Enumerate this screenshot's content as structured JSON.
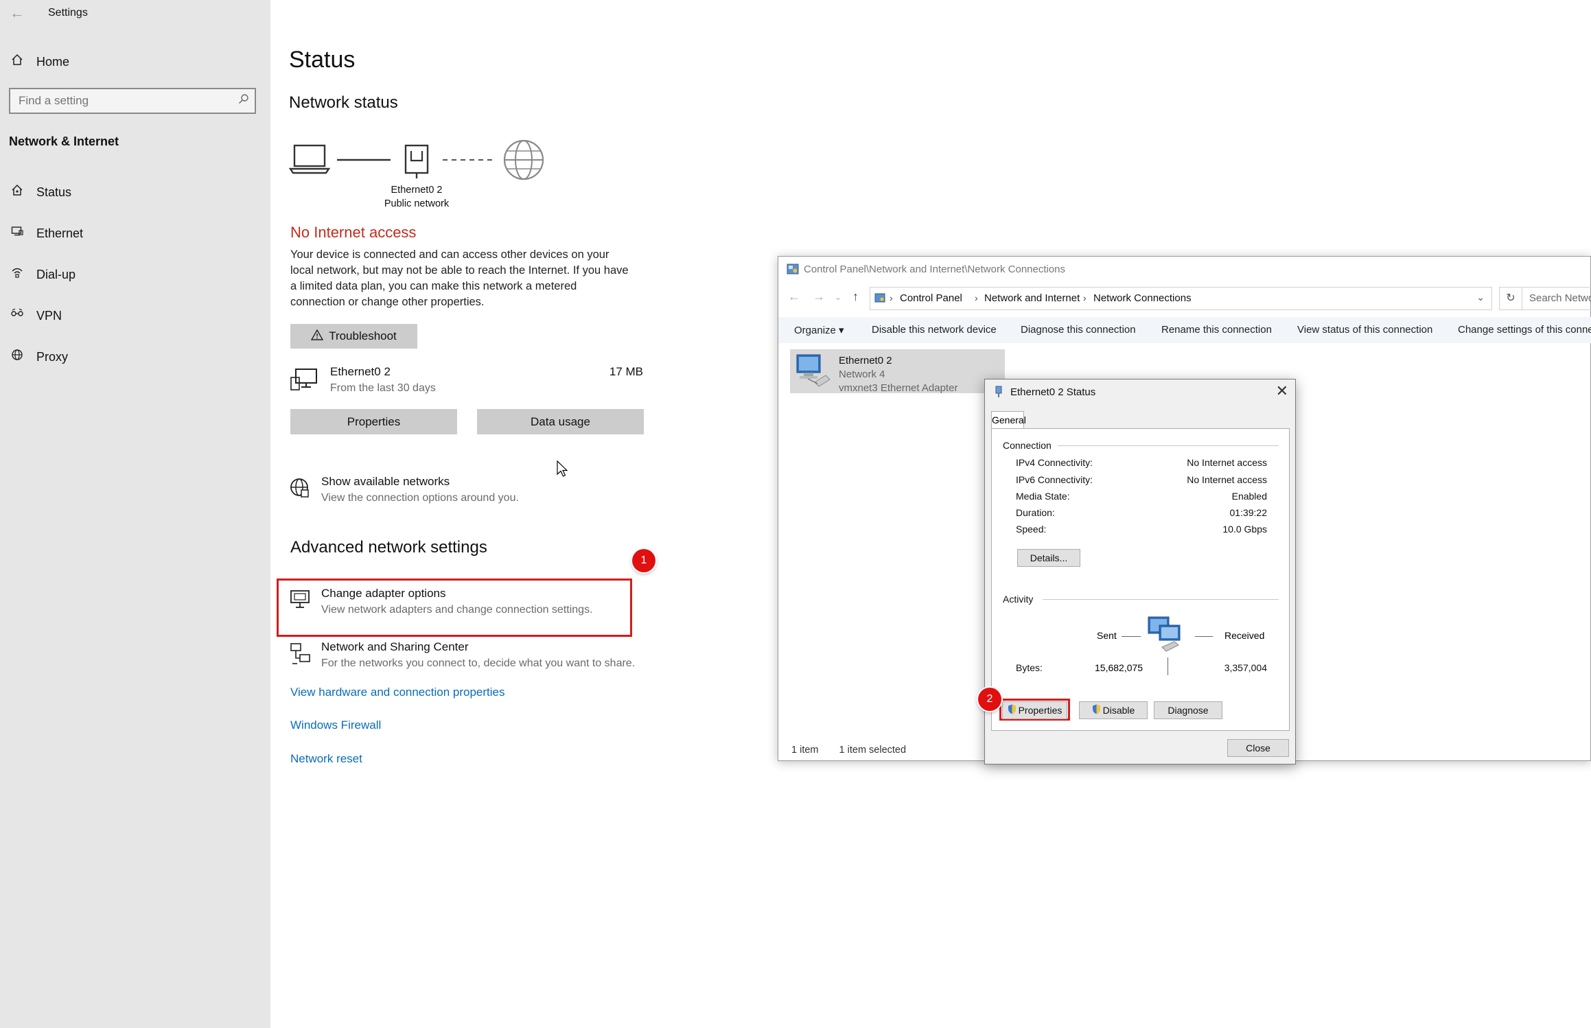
{
  "settings": {
    "app_title": "Settings",
    "home_label": "Home",
    "search_placeholder": "Find a setting",
    "section_title": "Network & Internet",
    "nav": [
      {
        "label": "Status",
        "icon": "home-network-icon"
      },
      {
        "label": "Ethernet",
        "icon": "ethernet-icon"
      },
      {
        "label": "Dial-up",
        "icon": "dialup-icon"
      },
      {
        "label": "VPN",
        "icon": "vpn-icon"
      },
      {
        "label": "Proxy",
        "icon": "globe-icon"
      }
    ]
  },
  "status_page": {
    "title": "Status",
    "network_status_heading": "Network status",
    "adapter_name": "Ethernet0 2",
    "network_type": "Public network",
    "no_internet": "No Internet access",
    "description": "Your device is connected and can access other devices on your local network, but may not be able to reach the Internet. If you have a limited data plan, you can make this network a metered connection or change other properties.",
    "troubleshoot_label": "Troubleshoot",
    "usage_adapter": "Ethernet0 2",
    "usage_period": "From the last 30 days",
    "usage_amount": "17 MB",
    "properties_label": "Properties",
    "data_usage_label": "Data usage",
    "show_networks_title": "Show available networks",
    "show_networks_sub": "View the connection options around you.",
    "advanced_heading": "Advanced network settings",
    "change_adapter_title": "Change adapter options",
    "change_adapter_sub": "View network adapters and change connection settings.",
    "sharing_center_title": "Network and Sharing Center",
    "sharing_center_sub": "For the networks you connect to, decide what you want to share.",
    "link_hardware": "View hardware and connection properties",
    "link_firewall": "Windows Firewall",
    "link_reset": "Network reset",
    "step_badge_1": "1"
  },
  "explorer": {
    "title": "Control Panel\\Network and Internet\\Network Connections",
    "breadcrumb": [
      "Control Panel",
      "Network and Internet",
      "Network Connections"
    ],
    "search_placeholder": "Search Netwo",
    "commands": [
      "Organize ▾",
      "Disable this network device",
      "Diagnose this connection",
      "Rename this connection",
      "View status of this connection",
      "Change settings of this conne"
    ],
    "item": {
      "name": "Ethernet0 2",
      "network": "Network 4",
      "adapter": "vmxnet3 Ethernet Adapter"
    },
    "status_count": "1 item",
    "status_selected": "1 item selected"
  },
  "status_dialog": {
    "title": "Ethernet0 2 Status",
    "tab": "General",
    "connection_group": "Connection",
    "rows": [
      {
        "key": "IPv4 Connectivity:",
        "value": "No Internet access"
      },
      {
        "key": "IPv6 Connectivity:",
        "value": "No Internet access"
      },
      {
        "key": "Media State:",
        "value": "Enabled"
      },
      {
        "key": "Duration:",
        "value": "01:39:22"
      },
      {
        "key": "Speed:",
        "value": "10.0 Gbps"
      }
    ],
    "details_label": "Details...",
    "activity_group": "Activity",
    "sent_label": "Sent",
    "received_label": "Received",
    "bytes_label": "Bytes:",
    "bytes_sent": "15,682,075",
    "bytes_received": "3,357,004",
    "properties_label": "Properties",
    "disable_label": "Disable",
    "diagnose_label": "Diagnose",
    "close_label": "Close",
    "step_badge_2": "2"
  },
  "colors": {
    "alert_red": "#c42b1c",
    "link_blue": "#0a6cb7",
    "highlight_red": "#d31d1d"
  }
}
